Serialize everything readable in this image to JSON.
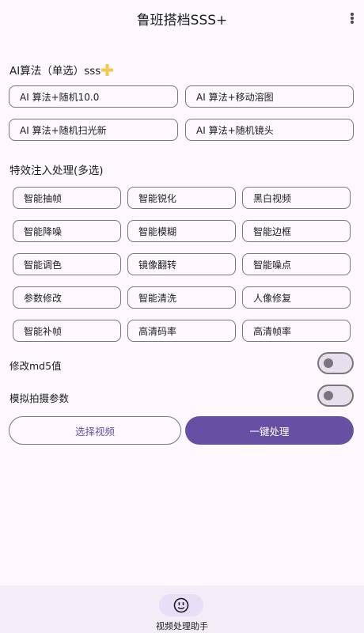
{
  "app_bar": {
    "title": "鲁班搭档SSS+",
    "menu_icon": "more-vert-icon"
  },
  "ai_section": {
    "title": "AI算法（单选）sss",
    "icon": "plus-icon",
    "icon_color": "#f2c94c",
    "options": [
      "AI 算法+随机10.0",
      "AI 算法+移动溶图",
      "AI 算法+随机扫光新",
      "AI 算法+随机镜头"
    ]
  },
  "effects_section": {
    "title": "特效注入处理(多选)",
    "options": [
      "智能抽帧",
      "智能锐化",
      "黑白视频",
      "智能降噪",
      "智能模糊",
      "智能边框",
      "智能调色",
      "镜像翻转",
      "智能噪点",
      "参数修改",
      "智能清洗",
      "人像修复",
      "智能补帧",
      "高清码率",
      "高清帧率"
    ]
  },
  "switches": [
    {
      "label": "修改md5值",
      "on": false
    },
    {
      "label": "模拟拍摄参数",
      "on": false
    }
  ],
  "actions": {
    "select_video": "选择视频",
    "one_click": "一键处理"
  },
  "bottom_nav": {
    "label": "视频处理助手",
    "icon": "smiley-face-icon"
  },
  "colors": {
    "primary": "#6750a4",
    "outline": "#79747e",
    "background": "#fdf8fd",
    "nav_background": "#f3edf7",
    "nav_indicator": "#e8def8"
  }
}
